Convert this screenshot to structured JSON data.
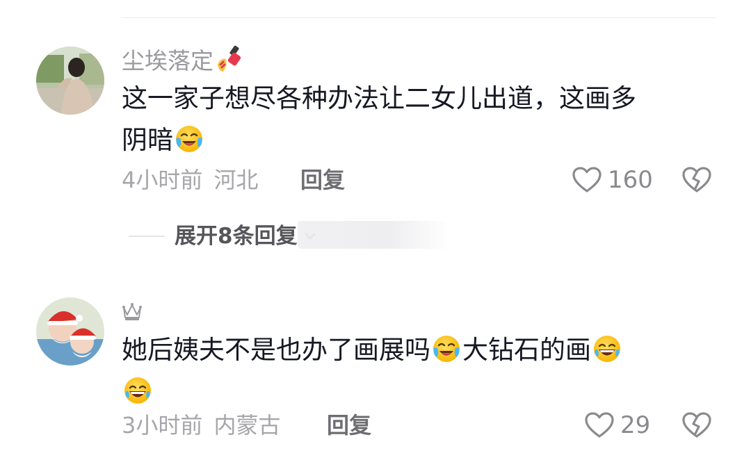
{
  "comments": [
    {
      "username": "尘埃落定",
      "username_icon": "nail-polish-icon",
      "text_line1": "这一家子想尽各种办法让二女儿出道，这画多",
      "text_line2": "阴暗",
      "emoji": "crying-laughing-icon",
      "time": "4小时前",
      "location": "河北",
      "reply_label": "回复",
      "likes": "160"
    },
    {
      "username": "",
      "username_icon": "crown-icon",
      "text_part1": "她后姨夫不是也办了画展吗",
      "text_part2": "大钻石的画",
      "emoji_a": "crying-laughing-icon",
      "emoji_b": "tears-of-joy-icon",
      "time": "3小时前",
      "location": "内蒙古",
      "reply_label": "回复",
      "likes": "29"
    }
  ],
  "expand_replies": {
    "label": "展开8条回复",
    "icon": "chevron-down-icon"
  },
  "colors": {
    "text": "#161823",
    "meta": "#a6a6aa",
    "emoji_face": "#ffcc33"
  }
}
